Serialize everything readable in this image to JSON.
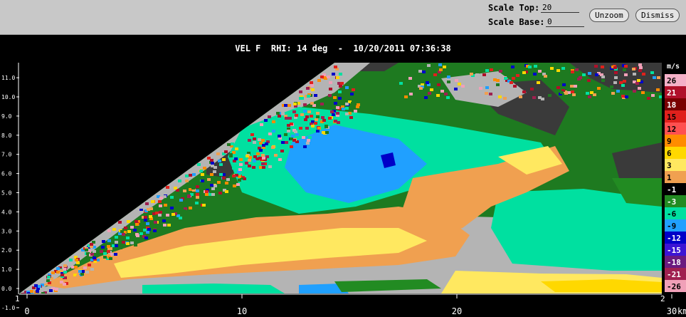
{
  "toolbar": {
    "scale_top_label": "Scale Top:",
    "scale_top_value": "20",
    "scale_base_label": "Scale Base:",
    "scale_base_value": "0",
    "unzoom_label": "Unzoom",
    "dismiss_label": "Dismiss"
  },
  "plot": {
    "title": "VEL F  RHI: 14 deg  -  10/20/2011 07:36:38",
    "y_ticks": [
      "11.0",
      "10.0",
      "9.0",
      "8.0",
      "7.0",
      "6.0",
      "5.0",
      "4.0",
      "3.0",
      "2.0",
      "1.0",
      "0.0",
      "-1.0"
    ],
    "x_ticks": [
      "0",
      "10",
      "20",
      "30"
    ],
    "x_unit": "km",
    "corner_marker_left": "1",
    "corner_marker_right": "2",
    "background_color": "#000000",
    "no_data_color": "#3a3a3a"
  },
  "colorbar": {
    "unit": "m/s",
    "entries": [
      {
        "label": "26",
        "color": "#f4b0c8"
      },
      {
        "label": "21",
        "color": "#b0102a"
      },
      {
        "label": "18",
        "color": "#7a0000"
      },
      {
        "label": "15",
        "color": "#e0201c"
      },
      {
        "label": "12",
        "color": "#ff5050"
      },
      {
        "label": "9",
        "color": "#ff8c00"
      },
      {
        "label": "6",
        "color": "#ffd800"
      },
      {
        "label": "3",
        "color": "#ffe860"
      },
      {
        "label": "1",
        "color": "#f0a050"
      },
      {
        "label": "-1",
        "color": "#000000"
      },
      {
        "label": "-3",
        "color": "#228b22"
      },
      {
        "label": "-6",
        "color": "#00e0a0"
      },
      {
        "label": "-9",
        "color": "#20a0ff"
      },
      {
        "label": "-12",
        "color": "#0000c8"
      },
      {
        "label": "-15",
        "color": "#3c14d4"
      },
      {
        "label": "-18",
        "color": "#6a1a80"
      },
      {
        "label": "-21",
        "color": "#a02050"
      },
      {
        "label": "-26",
        "color": "#f0a0b8"
      }
    ]
  }
}
